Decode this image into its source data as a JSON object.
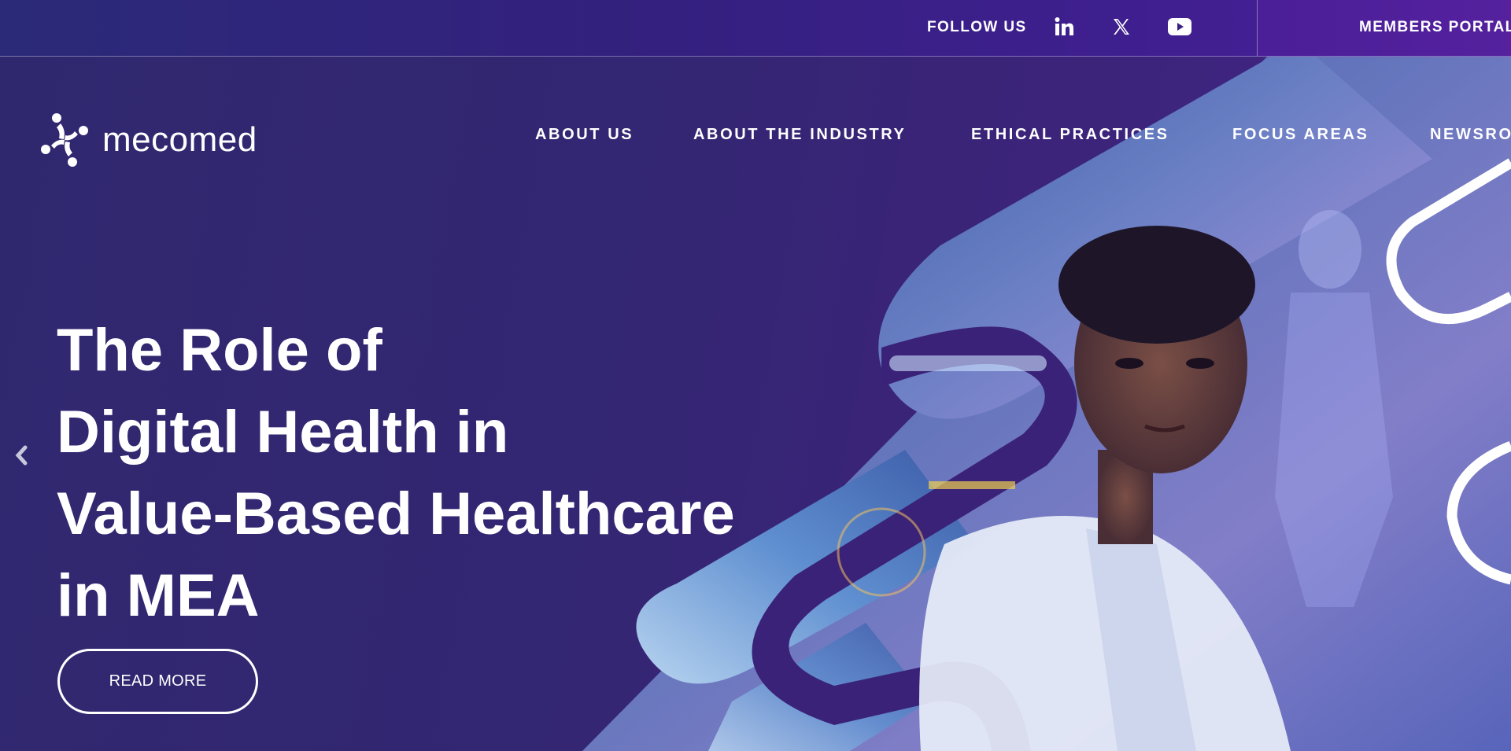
{
  "topbar": {
    "follow_label": "FOLLOW US",
    "social": [
      {
        "icon": "linkedin-icon",
        "label": "in"
      },
      {
        "icon": "x-icon",
        "label": "X"
      },
      {
        "icon": "youtube-icon",
        "label": "YouTube"
      }
    ],
    "members_portal_label": "MEMBERS PORTAL"
  },
  "header": {
    "logo_text": "mecomed",
    "nav": [
      "ABOUT US",
      "ABOUT THE INDUSTRY",
      "ETHICAL PRACTICES",
      "FOCUS AREAS",
      "NEWSRO"
    ]
  },
  "hero": {
    "headline_lines": [
      "The Role of",
      "Digital Health in",
      "Value-Based Healthcare",
      "in MEA"
    ],
    "button_label": "READ MORE",
    "prev_icon": "chevron-left-icon"
  },
  "colors": {
    "background": "#2d2670",
    "accent_purple": "#4a1f98",
    "stripe_blue": "#5b8fd0"
  }
}
